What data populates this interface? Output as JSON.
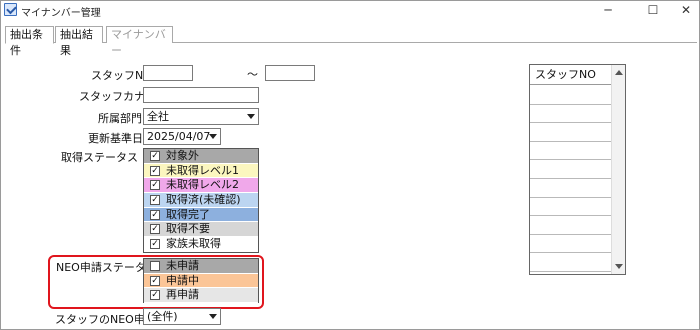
{
  "window": {
    "title": "マイナンバー管理",
    "controls": {
      "minimize": "─",
      "maximize": "☐",
      "close": "✕"
    }
  },
  "tabs": [
    {
      "label": "抽出条件",
      "state": "active"
    },
    {
      "label": "抽出結果",
      "state": "normal"
    },
    {
      "label": "マイナンバー",
      "state": "disabled"
    }
  ],
  "form": {
    "staff_no_label": "スタッフNO",
    "staff_no_from": "",
    "range_sep": "～",
    "staff_no_to": "",
    "staff_kana_label": "スタッフカナ",
    "staff_kana_value": "",
    "dept_label": "所属部門",
    "dept_value": "全社",
    "base_date_label": "更新基準日",
    "base_date_value": "2025/04/07",
    "acq_status_label": "取得ステータス",
    "neo_status_label": "NEO申請ステータス",
    "neo_apply_label": "スタッフのNEO申請",
    "neo_apply_value": "(全件)"
  },
  "acq_status": [
    {
      "label": "対象外",
      "checked": true,
      "color": "#a8a8a8"
    },
    {
      "label": "未取得レベル1",
      "checked": true,
      "color": "#fbf6bf"
    },
    {
      "label": "未取得レベル2",
      "checked": true,
      "color": "#f0a8ea"
    },
    {
      "label": "取得済(未確認)",
      "checked": true,
      "color": "#bcd5f1"
    },
    {
      "label": "取得完了",
      "checked": true,
      "color": "#8db0de"
    },
    {
      "label": "取得不要",
      "checked": true,
      "color": "#d6d6d6"
    },
    {
      "label": "家族未取得",
      "checked": true,
      "color": "#ffffff"
    }
  ],
  "neo_status": [
    {
      "label": "未申請",
      "checked": false,
      "color": "#a8a8a8"
    },
    {
      "label": "申請中",
      "checked": true,
      "color": "#fbc597"
    },
    {
      "label": "再申請",
      "checked": true,
      "color": "#e6e6e6"
    }
  ],
  "result_grid": {
    "header": "スタッフNO"
  },
  "icons": {
    "checkmark": "✓"
  }
}
